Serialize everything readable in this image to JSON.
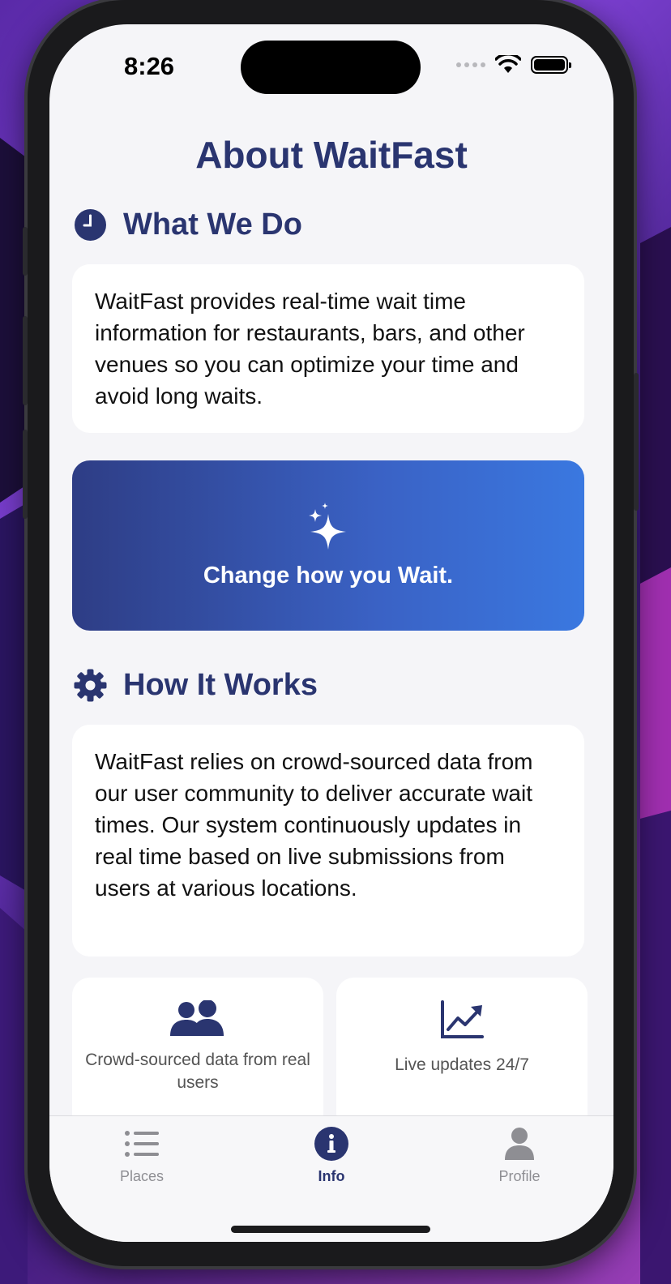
{
  "status_bar": {
    "time": "8:26"
  },
  "page": {
    "title": "About WaitFast"
  },
  "what_we_do": {
    "heading": "What We Do",
    "icon": "clock-icon",
    "body": "WaitFast provides real-time wait time information for restaurants, bars, and other venues so you can optimize your time and avoid long waits."
  },
  "banner": {
    "icon": "sparkles-icon",
    "text": "Change how you Wait."
  },
  "how_it_works": {
    "heading": "How It Works",
    "icon": "gear-icon",
    "body": "WaitFast relies on crowd-sourced data from our user community to deliver accurate wait times. Our system continuously updates in real time based on live submissions from users at various locations."
  },
  "features": [
    {
      "icon": "people-icon",
      "text": "Crowd-sourced data from real users"
    },
    {
      "icon": "chart-up-icon",
      "text": "Live updates 24/7"
    }
  ],
  "tabs": [
    {
      "label": "Places",
      "icon": "list-icon",
      "active": false
    },
    {
      "label": "Info",
      "icon": "info-icon",
      "active": true
    },
    {
      "label": "Profile",
      "icon": "person-icon",
      "active": false
    }
  ],
  "colors": {
    "accent": "#2a3570",
    "banner_start": "#2e3d85",
    "banner_end": "#3a78e0",
    "inactive": "#8e8e93"
  }
}
